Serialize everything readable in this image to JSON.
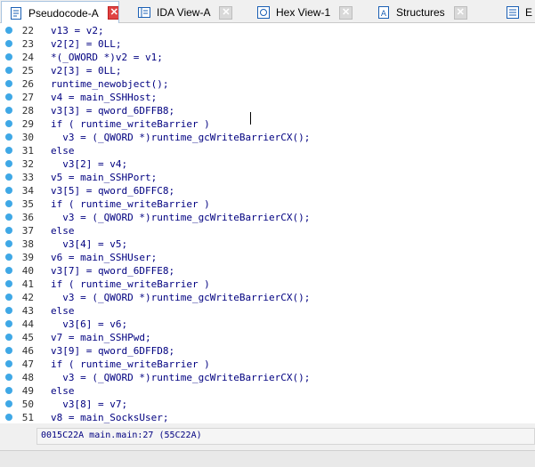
{
  "tabs": [
    {
      "label": "Pseudocode-A",
      "icon": "pseudocode-icon"
    },
    {
      "label": "IDA View-A",
      "icon": "ida-view-icon"
    },
    {
      "label": "Hex View-1",
      "icon": "hex-view-icon"
    },
    {
      "label": "Structures",
      "icon": "structures-icon"
    },
    {
      "label": "E",
      "icon": "enums-icon"
    }
  ],
  "close_glyph": "✕",
  "lines": [
    {
      "n": "22",
      "code": "v13 = v2;"
    },
    {
      "n": "23",
      "code": "v2[2] = 0LL;"
    },
    {
      "n": "24",
      "code": "*(_OWORD *)v2 = v1;"
    },
    {
      "n": "25",
      "code": "v2[3] = 0LL;"
    },
    {
      "n": "26",
      "code": "runtime_newobject();"
    },
    {
      "n": "27",
      "code": "v4 = main_SSHHost;"
    },
    {
      "n": "28",
      "code": "v3[3] = qword_6DFFB8;"
    },
    {
      "n": "29",
      "code": "if ( runtime_writeBarrier )"
    },
    {
      "n": "30",
      "code": "  v3 = (_QWORD *)runtime_gcWriteBarrierCX();"
    },
    {
      "n": "31",
      "code": "else"
    },
    {
      "n": "32",
      "code": "  v3[2] = v4;"
    },
    {
      "n": "33",
      "code": "v5 = main_SSHPort;"
    },
    {
      "n": "34",
      "code": "v3[5] = qword_6DFFC8;"
    },
    {
      "n": "35",
      "code": "if ( runtime_writeBarrier )"
    },
    {
      "n": "36",
      "code": "  v3 = (_QWORD *)runtime_gcWriteBarrierCX();"
    },
    {
      "n": "37",
      "code": "else"
    },
    {
      "n": "38",
      "code": "  v3[4] = v5;"
    },
    {
      "n": "39",
      "code": "v6 = main_SSHUser;"
    },
    {
      "n": "40",
      "code": "v3[7] = qword_6DFFE8;"
    },
    {
      "n": "41",
      "code": "if ( runtime_writeBarrier )"
    },
    {
      "n": "42",
      "code": "  v3 = (_QWORD *)runtime_gcWriteBarrierCX();"
    },
    {
      "n": "43",
      "code": "else"
    },
    {
      "n": "44",
      "code": "  v3[6] = v6;"
    },
    {
      "n": "45",
      "code": "v7 = main_SSHPwd;"
    },
    {
      "n": "46",
      "code": "v3[9] = qword_6DFFD8;"
    },
    {
      "n": "47",
      "code": "if ( runtime_writeBarrier )"
    },
    {
      "n": "48",
      "code": "  v3 = (_QWORD *)runtime_gcWriteBarrierCX();"
    },
    {
      "n": "49",
      "code": "else"
    },
    {
      "n": "50",
      "code": "  v3[8] = v7;"
    },
    {
      "n": "51",
      "code": "v8 = main_SocksUser;"
    }
  ],
  "status": {
    "address": "0015C22A main.main:27 (55C22A)"
  },
  "colors": {
    "code": "#000080",
    "breakpoint": "#3fa8e6",
    "active_close": "#e04343"
  }
}
